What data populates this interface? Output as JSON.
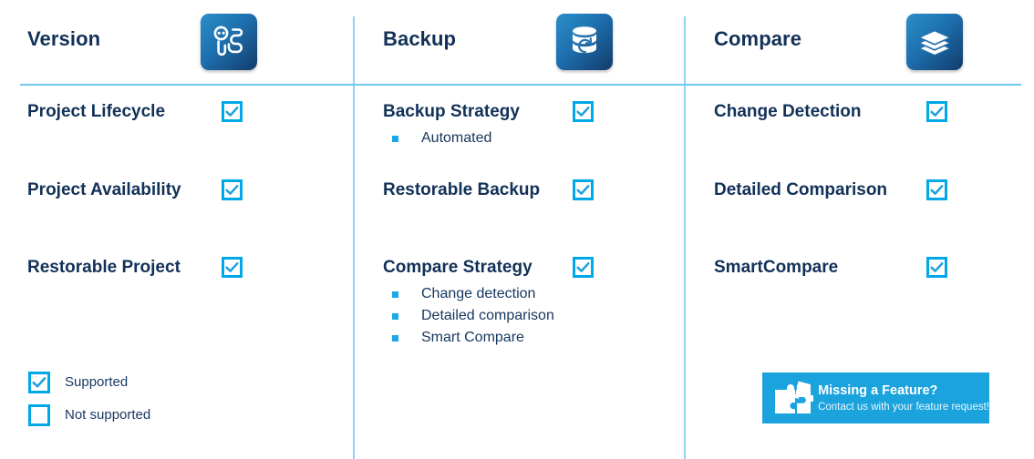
{
  "columns": [
    {
      "title": "Version",
      "icon": "version-tree-icon",
      "features": [
        {
          "label": "Project Lifecycle",
          "supported": true,
          "sub": []
        },
        {
          "label": "Project Availability",
          "supported": true,
          "sub": []
        },
        {
          "label": "Restorable Project",
          "supported": true,
          "sub": []
        }
      ]
    },
    {
      "title": "Backup",
      "icon": "database-restore-icon",
      "features": [
        {
          "label": "Backup Strategy",
          "supported": true,
          "sub": [
            "Automated"
          ]
        },
        {
          "label": "Restorable Backup",
          "supported": true,
          "sub": []
        },
        {
          "label": "Compare Strategy",
          "supported": true,
          "sub": [
            "Change detection",
            "Detailed comparison",
            "Smart Compare"
          ]
        }
      ]
    },
    {
      "title": "Compare",
      "icon": "layers-icon",
      "features": [
        {
          "label": "Change Detection",
          "supported": true,
          "sub": []
        },
        {
          "label": "Detailed Comparison",
          "supported": true,
          "sub": []
        },
        {
          "label": "SmartCompare",
          "supported": true,
          "sub": []
        }
      ]
    }
  ],
  "legend": [
    {
      "label": "Supported",
      "checked": true
    },
    {
      "label": "Not supported",
      "checked": false
    }
  ],
  "banner": {
    "icon": "puzzle-piece-icon",
    "title": "Missing a Feature?",
    "subtitle": "Contact us with your feature request!"
  },
  "colors": {
    "accent": "#00A8E8",
    "navy": "#123158",
    "divider": "#8FD4F5",
    "banner_bg": "#1AA3DD"
  }
}
